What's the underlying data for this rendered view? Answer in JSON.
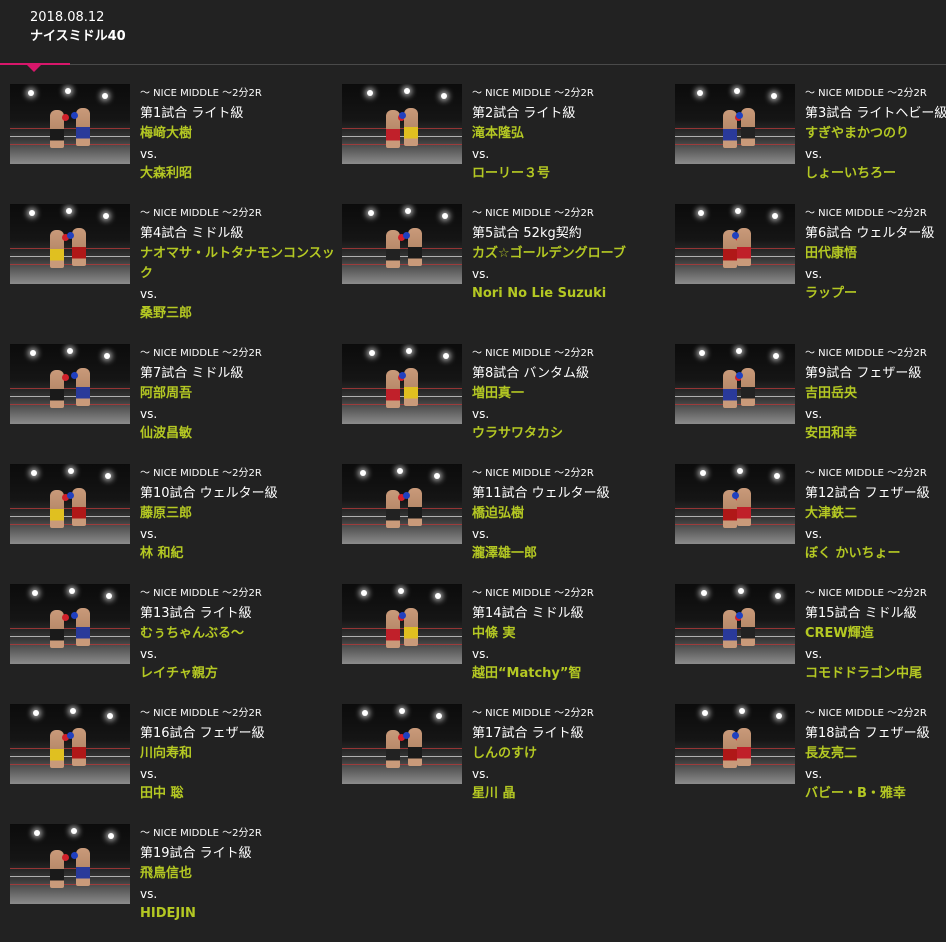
{
  "header": {
    "date": "2018.08.12",
    "title": "ナイスミドル40"
  },
  "colors": {
    "background": "#222222",
    "accent": "#d8176b",
    "fighter_name": "#b4c823"
  },
  "vs_label": "vs.",
  "bouts": [
    {
      "event": "～ NICE MIDDLE ～2分2R",
      "match": "第1試合 ライト級",
      "fighter1": "梅﨑大樹",
      "fighter2": "大森利昭"
    },
    {
      "event": "～ NICE MIDDLE ～2分2R",
      "match": "第2試合 ライト級",
      "fighter1": "滝本隆弘",
      "fighter2": "ローリー３号"
    },
    {
      "event": "～ NICE MIDDLE ～2分2R",
      "match": "第3試合 ライトヘビー級",
      "fighter1": "すぎやまかつのり",
      "fighter2": "しょーいちろー"
    },
    {
      "event": "～ NICE MIDDLE ～2分2R",
      "match": "第4試合 ミドル級",
      "fighter1": "ナオマサ・ルトタナモンコンスック",
      "fighter2": "桑野三郎"
    },
    {
      "event": "～ NICE MIDDLE ～2分2R",
      "match": "第5試合 52kg契約",
      "fighter1": "カズ☆ゴールデングローブ",
      "fighter2": "Nori No Lie Suzuki"
    },
    {
      "event": "～ NICE MIDDLE ～2分2R",
      "match": "第6試合 ウェルター級",
      "fighter1": "田代康悟",
      "fighter2": "ラップー"
    },
    {
      "event": "～ NICE MIDDLE ～2分2R",
      "match": "第7試合 ミドル級",
      "fighter1": "阿部周吾",
      "fighter2": "仙波昌敏"
    },
    {
      "event": "～ NICE MIDDLE ～2分2R",
      "match": "第8試合 バンタム級",
      "fighter1": "増田真一",
      "fighter2": "ウラサワタカシ"
    },
    {
      "event": "～ NICE MIDDLE ～2分2R",
      "match": "第9試合 フェザー級",
      "fighter1": "吉田岳央",
      "fighter2": "安田和幸"
    },
    {
      "event": "～ NICE MIDDLE ～2分2R",
      "match": "第10試合 ウェルター級",
      "fighter1": "藤原三郎",
      "fighter2": "林 和紀"
    },
    {
      "event": "～ NICE MIDDLE ～2分2R",
      "match": "第11試合 ウェルター級",
      "fighter1": "橋迫弘樹",
      "fighter2": "瀧澤雄一郎"
    },
    {
      "event": "～ NICE MIDDLE ～2分2R",
      "match": "第12試合 フェザー級",
      "fighter1": "大津鉄二",
      "fighter2": "ぼく かいちょー"
    },
    {
      "event": "～ NICE MIDDLE ～2分2R",
      "match": "第13試合 ライト級",
      "fighter1": "むぅちゃんぶる～",
      "fighter2": "レイチャ親方"
    },
    {
      "event": "～ NICE MIDDLE ～2分2R",
      "match": "第14試合 ミドル級",
      "fighter1": "中條 実",
      "fighter2": "越田“Matchy”智"
    },
    {
      "event": "～ NICE MIDDLE ～2分2R",
      "match": "第15試合 ミドル級",
      "fighter1": "CREW輝造",
      "fighter2": "コモドドラゴン中尾"
    },
    {
      "event": "～ NICE MIDDLE ～2分2R",
      "match": "第16試合 フェザー級",
      "fighter1": "川向寿和",
      "fighter2": "田中 聡"
    },
    {
      "event": "～ NICE MIDDLE ～2分2R",
      "match": "第17試合 ライト級",
      "fighter1": "しんのすけ",
      "fighter2": "星川 晶"
    },
    {
      "event": "～ NICE MIDDLE ～2分2R",
      "match": "第18試合 フェザー級",
      "fighter1": "長友亮二",
      "fighter2": "バビー・B・雅幸"
    },
    {
      "event": "～ NICE MIDDLE ～2分2R",
      "match": "第19試合 ライト級",
      "fighter1": "飛鳥信也",
      "fighter2": "HIDEJIN"
    }
  ]
}
